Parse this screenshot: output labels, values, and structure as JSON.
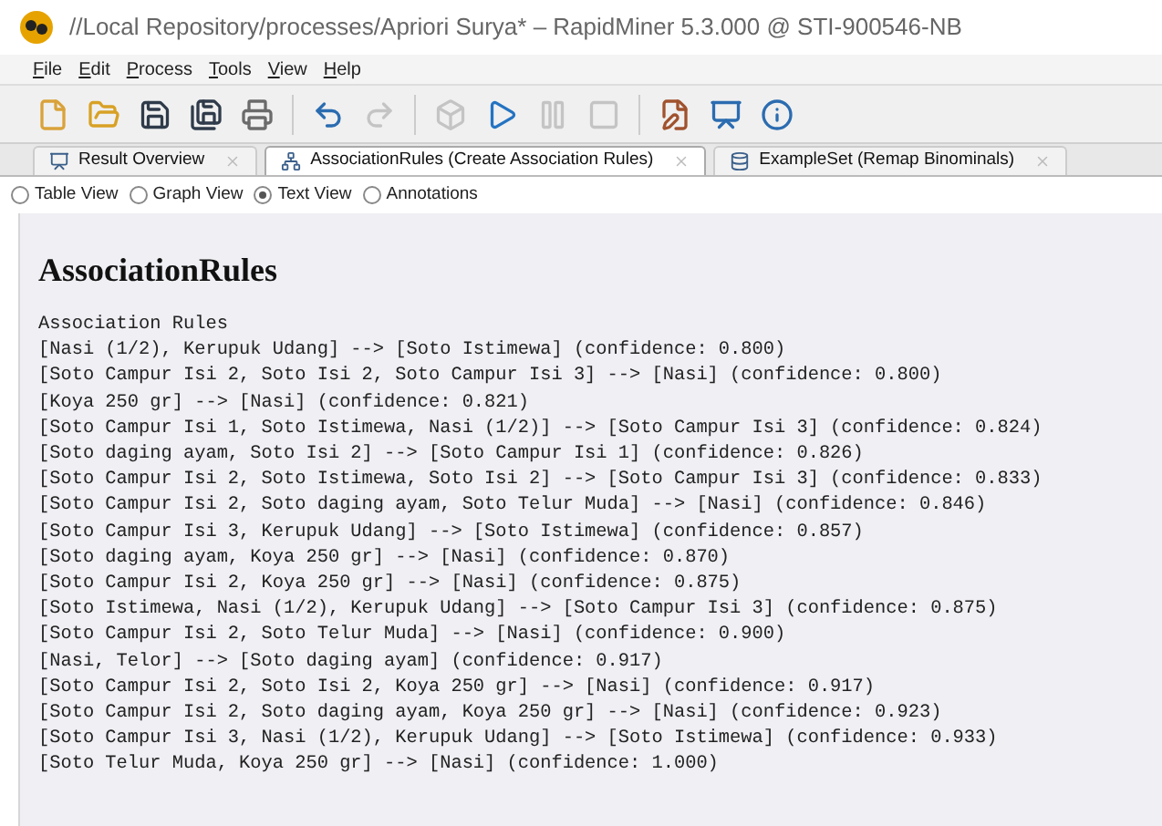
{
  "window": {
    "title": "//Local Repository/processes/Apriori Surya* – RapidMiner 5.3.000 @ STI-900546-NB"
  },
  "menu": [
    "File",
    "Edit",
    "Process",
    "Tools",
    "View",
    "Help"
  ],
  "toolbar": [
    {
      "kind": "new",
      "disabled": false
    },
    {
      "kind": "open",
      "disabled": false
    },
    {
      "kind": "save",
      "disabled": false
    },
    {
      "kind": "save-as",
      "disabled": false
    },
    {
      "kind": "print",
      "disabled": false
    },
    {
      "kind": "undo",
      "disabled": false
    },
    {
      "kind": "redo",
      "disabled": true
    },
    {
      "kind": "step",
      "disabled": true
    },
    {
      "kind": "run",
      "disabled": false
    },
    {
      "kind": "pause",
      "disabled": true
    },
    {
      "kind": "stop",
      "disabled": true
    },
    {
      "kind": "design",
      "disabled": false
    },
    {
      "kind": "results",
      "disabled": false
    },
    {
      "kind": "info",
      "disabled": false
    }
  ],
  "tabs": [
    {
      "label": "Result Overview",
      "kind": "overview",
      "selected": false
    },
    {
      "label": "AssociationRules (Create Association Rules)",
      "kind": "rules",
      "selected": true
    },
    {
      "label": "ExampleSet (Remap Binominals)",
      "kind": "table",
      "selected": false
    }
  ],
  "views": [
    {
      "label": "Table View",
      "selected": false
    },
    {
      "label": "Graph View",
      "selected": false
    },
    {
      "label": "Text View",
      "selected": true
    },
    {
      "label": "Annotations",
      "selected": false
    }
  ],
  "content": {
    "heading": "AssociationRules",
    "subheading": "Association Rules",
    "rules": [
      "[Nasi (1/2), Kerupuk Udang] --> [Soto Istimewa] (confidence: 0.800)",
      "[Soto Campur Isi 2, Soto Isi 2, Soto Campur Isi 3] --> [Nasi] (confidence: 0.800)",
      "[Koya 250 gr] --> [Nasi] (confidence: 0.821)",
      "[Soto Campur Isi 1, Soto Istimewa, Nasi (1/2)] --> [Soto Campur Isi 3] (confidence: 0.824)",
      "[Soto daging ayam, Soto Isi 2] --> [Soto Campur Isi 1] (confidence: 0.826)",
      "[Soto Campur Isi 2, Soto Istimewa, Soto Isi 2] --> [Soto Campur Isi 3] (confidence: 0.833)",
      "[Soto Campur Isi 2, Soto daging ayam, Soto Telur Muda] --> [Nasi] (confidence: 0.846)",
      "[Soto Campur Isi 3, Kerupuk Udang] --> [Soto Istimewa] (confidence: 0.857)",
      "[Soto daging ayam, Koya 250 gr] --> [Nasi] (confidence: 0.870)",
      "[Soto Campur Isi 2, Koya 250 gr] --> [Nasi] (confidence: 0.875)",
      "[Soto Istimewa, Nasi (1/2), Kerupuk Udang] --> [Soto Campur Isi 3] (confidence: 0.875)",
      "[Soto Campur Isi 2, Soto Telur Muda] --> [Nasi] (confidence: 0.900)",
      "[Nasi, Telor] --> [Soto daging ayam] (confidence: 0.917)",
      "[Soto Campur Isi 2, Soto Isi 2, Koya 250 gr] --> [Nasi] (confidence: 0.917)",
      "[Soto Campur Isi 2, Soto daging ayam, Koya 250 gr] --> [Nasi] (confidence: 0.923)",
      "[Soto Campur Isi 3, Nasi (1/2), Kerupuk Udang] --> [Soto Istimewa] (confidence: 0.933)",
      "[Soto Telur Muda, Koya 250 gr] --> [Nasi] (confidence: 1.000)"
    ]
  }
}
